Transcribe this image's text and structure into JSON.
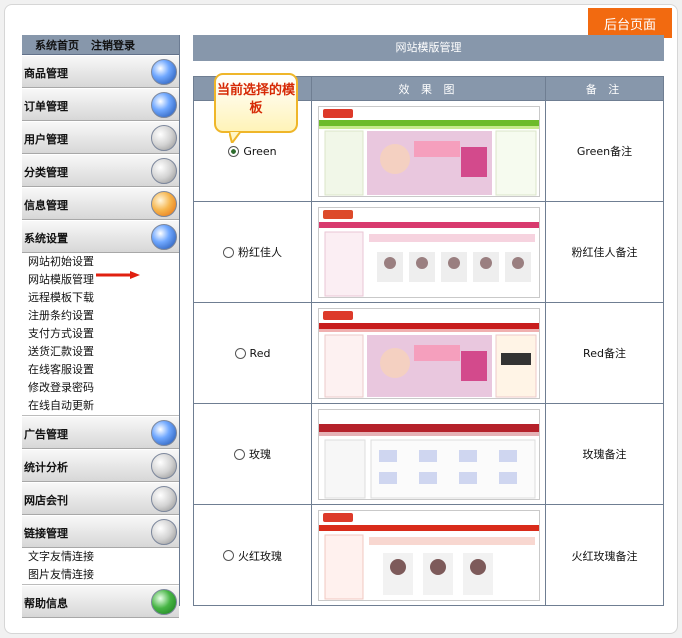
{
  "corner_tag": "后台页面",
  "topnav": {
    "home": "系统首页",
    "logout": "注销登录"
  },
  "sidebar": {
    "sections": [
      {
        "title": "商品管理",
        "icon": "pin-icon"
      },
      {
        "title": "订单管理",
        "icon": "globe-icon"
      },
      {
        "title": "用户管理",
        "icon": "clock-icon"
      },
      {
        "title": "分类管理",
        "icon": "arrow-icon"
      },
      {
        "title": "信息管理",
        "icon": "orange-ball-icon"
      },
      {
        "title": "系统设置",
        "icon": "search-icon"
      }
    ],
    "system_items": [
      "网站初始设置",
      "网站模版管理",
      "远程模板下载",
      "注册条约设置",
      "支付方式设置",
      "送货汇款设置",
      "在线客服设置",
      "修改登录密码",
      "在线自动更新"
    ],
    "sections_after": [
      {
        "title": "广告管理",
        "icon": "globe-icon"
      },
      {
        "title": "统计分析",
        "icon": "windows-icon"
      },
      {
        "title": "网店会刊",
        "icon": "document-icon"
      }
    ],
    "link_section": {
      "title": "链接管理",
      "icon": "gear-icon"
    },
    "link_items": [
      "文字友情连接",
      "图片友情连接"
    ],
    "help_section": {
      "title": "帮助信息",
      "icon": "help-icon"
    }
  },
  "main": {
    "title": "网站模版管理",
    "columns": [
      "",
      "效 果 图",
      "备 注"
    ],
    "callout": "当前选择的模板",
    "rows": [
      {
        "name": "Green",
        "note": "Green备注",
        "selected": true,
        "accent": "#6dbb2a"
      },
      {
        "name": "粉红佳人",
        "note": "粉红佳人备注",
        "selected": false,
        "accent": "#d83a6e"
      },
      {
        "name": "Red",
        "note": "Red备注",
        "selected": false,
        "accent": "#c81d1d"
      },
      {
        "name": "玫瑰",
        "note": "玫瑰备注",
        "selected": false,
        "accent": "#b5212a"
      },
      {
        "name": "火红玫瑰",
        "note": "火红玫瑰备注",
        "selected": false,
        "accent": "#d92b1a"
      }
    ]
  }
}
